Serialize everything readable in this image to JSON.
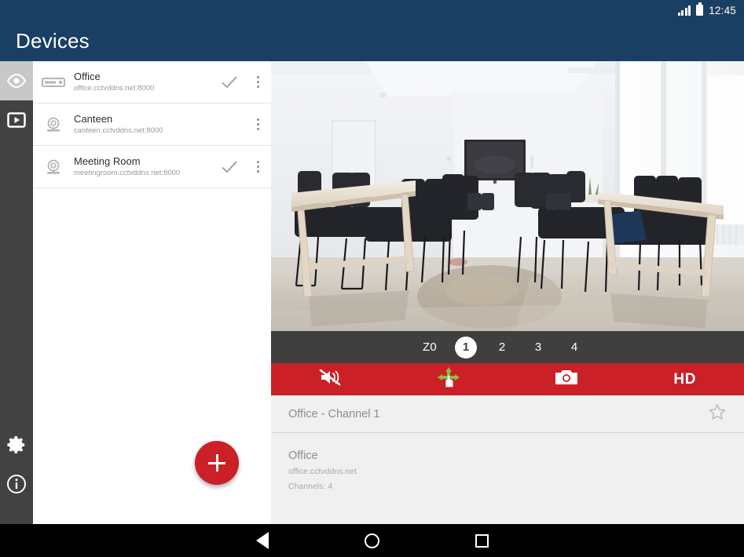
{
  "statusbar": {
    "time": "12:45",
    "signal_icon": "signal-bars-icon",
    "battery_icon": "battery-icon"
  },
  "appbar": {
    "title": "Devices"
  },
  "rail": {
    "items": [
      {
        "name": "live-view",
        "icon": "eye-icon",
        "active": true
      },
      {
        "name": "playback",
        "icon": "play-icon",
        "active": false
      },
      {
        "name": "settings",
        "icon": "gear-icon",
        "active": false
      },
      {
        "name": "about",
        "icon": "info-icon",
        "active": false
      }
    ]
  },
  "devices": {
    "rows": [
      {
        "name": "Office",
        "address": "office.cctvddns.net:8000",
        "icon": "nvr-icon",
        "checked": true
      },
      {
        "name": "Canteen",
        "address": "canteen.cctvddns.net:8000",
        "icon": "camera-dome-icon",
        "checked": false
      },
      {
        "name": "Meeting Room",
        "address": "meetingroom.cctvddns.net:8000",
        "icon": "camera-dome-icon",
        "checked": true
      }
    ],
    "add_label": "+"
  },
  "player": {
    "zoom_label": "Z0",
    "channels": [
      "1",
      "2",
      "3",
      "4"
    ],
    "selected_channel": "1",
    "toolbar": [
      {
        "name": "mute-toggle",
        "icon": "speaker-mute-icon",
        "label": ""
      },
      {
        "name": "ptz-control",
        "icon": "ptz-arrows-icon",
        "label": ""
      },
      {
        "name": "snapshot",
        "icon": "camera-shutter-icon",
        "label": ""
      },
      {
        "name": "quality-toggle",
        "icon": "hd-label",
        "label": "HD"
      }
    ]
  },
  "detail": {
    "channel_title": "Office - Channel 1",
    "favorite_icon": "star-outline-icon",
    "device_name": "Office",
    "device_host": "office.cctvddns.net",
    "channel_count": "Channels: 4"
  },
  "navbar": {
    "back": "back-icon",
    "home": "home-icon",
    "recents": "recents-icon"
  },
  "colors": {
    "appbar": "#1b3f63",
    "accent_red": "#cc2027",
    "rail": "#424242",
    "chanbar": "#3f3f3f",
    "panel": "#f0f0f0"
  }
}
